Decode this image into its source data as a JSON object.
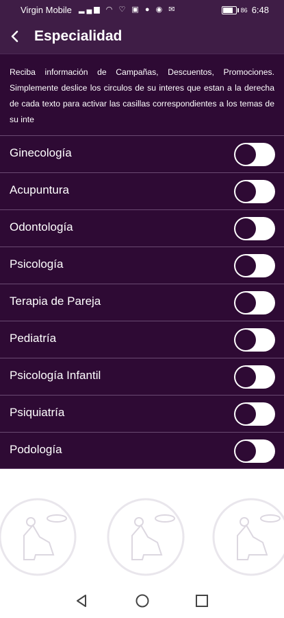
{
  "status_bar": {
    "carrier": "Virgin Mobile",
    "battery": "86",
    "time": "6:48"
  },
  "header": {
    "title": "Especialidad"
  },
  "intro": {
    "text": "Reciba información de Campañas, Descuentos, Promociones. Simplemente deslice los circulos de su interes que estan a la derecha de cada texto para activar las casillas correspondientes a los temas de su inte"
  },
  "specialties": [
    {
      "label": "Ginecología",
      "enabled": false
    },
    {
      "label": "Acupuntura",
      "enabled": false
    },
    {
      "label": "Odontología",
      "enabled": false
    },
    {
      "label": "Psicología",
      "enabled": false
    },
    {
      "label": "Terapia de Pareja",
      "enabled": false
    },
    {
      "label": "Pediatría",
      "enabled": false
    },
    {
      "label": "Psicología Infantil",
      "enabled": false
    },
    {
      "label": "Psiquiatría",
      "enabled": false
    },
    {
      "label": "Podología",
      "enabled": false
    }
  ],
  "colors": {
    "primary": "#3f1d46",
    "list_bg": "#2e0a34",
    "divider": "#6a4a72",
    "switch_track": "#ffffff"
  },
  "icons": {
    "back": "chevron-left-icon",
    "nav_back": "triangle-back-icon",
    "nav_home": "circle-home-icon",
    "nav_recents": "square-recents-icon"
  }
}
